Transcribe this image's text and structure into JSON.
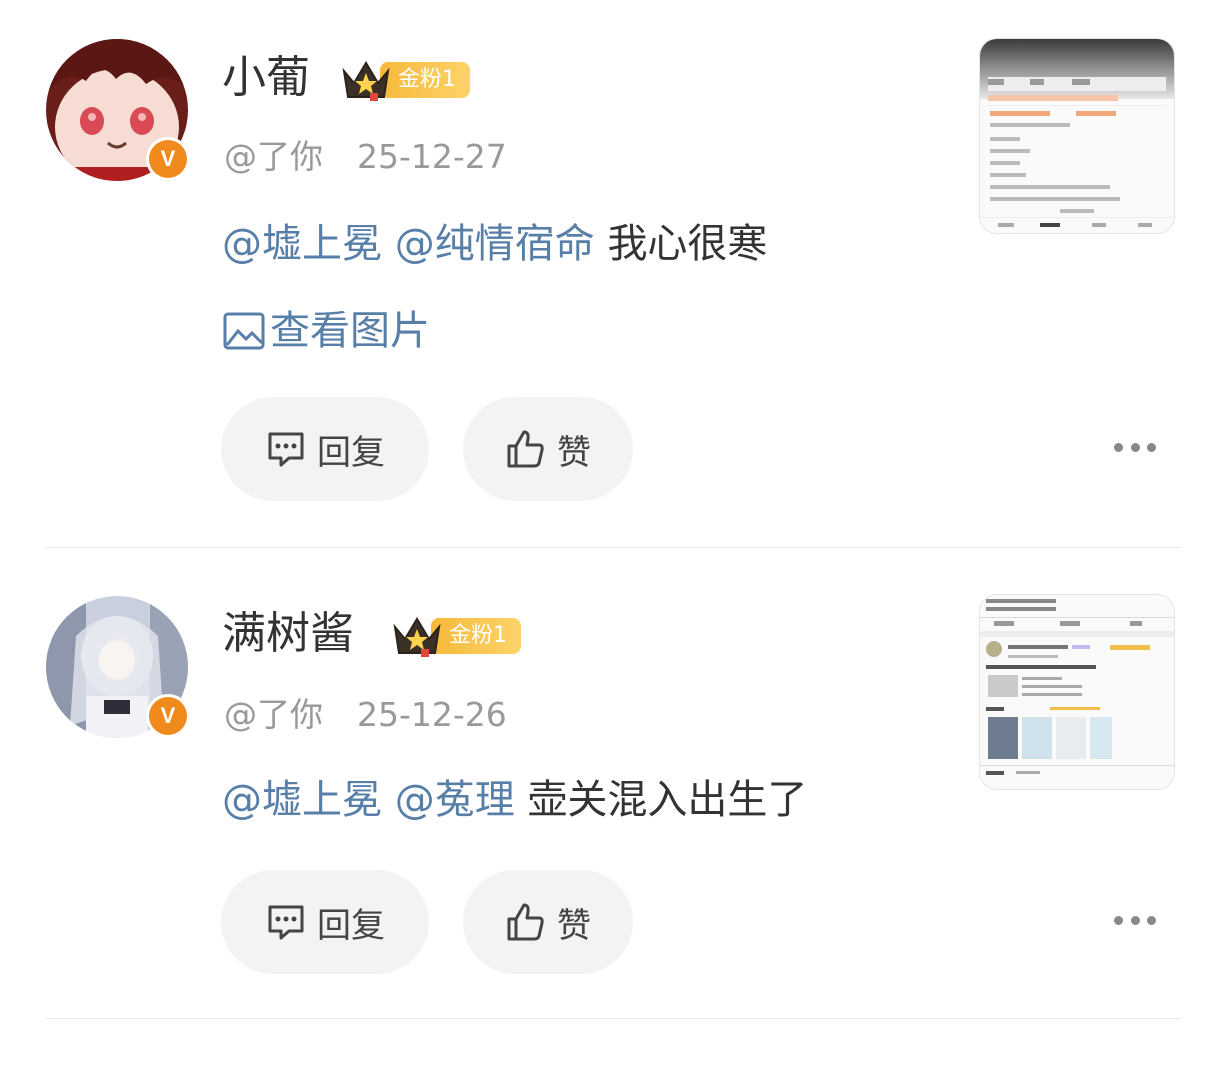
{
  "comments": [
    {
      "username": "小葡",
      "fan_badge": "金粉1",
      "handle": "@了你",
      "date": "25-12-27",
      "mentions": [
        "@墟上冕",
        "@纯情宿命"
      ],
      "text": "我心很寒",
      "view_image_label": "查看图片",
      "reply_label": "回复",
      "like_label": "赞",
      "avatar_desc": "plush-doll-avatar"
    },
    {
      "username": "满树酱",
      "fan_badge": "金粉1",
      "handle": "@了你",
      "date": "25-12-26",
      "mentions": [
        "@墟上冕",
        "@菟理"
      ],
      "text": "壶关混入出生了",
      "reply_label": "回复",
      "like_label": "赞",
      "avatar_desc": "anime-girl-avatar"
    }
  ],
  "colors": {
    "mention": "#577fa8",
    "badge_orange": "#f08a1c",
    "fan_badge_gold": "#f7b93a",
    "button_bg": "#f3f3f3"
  }
}
